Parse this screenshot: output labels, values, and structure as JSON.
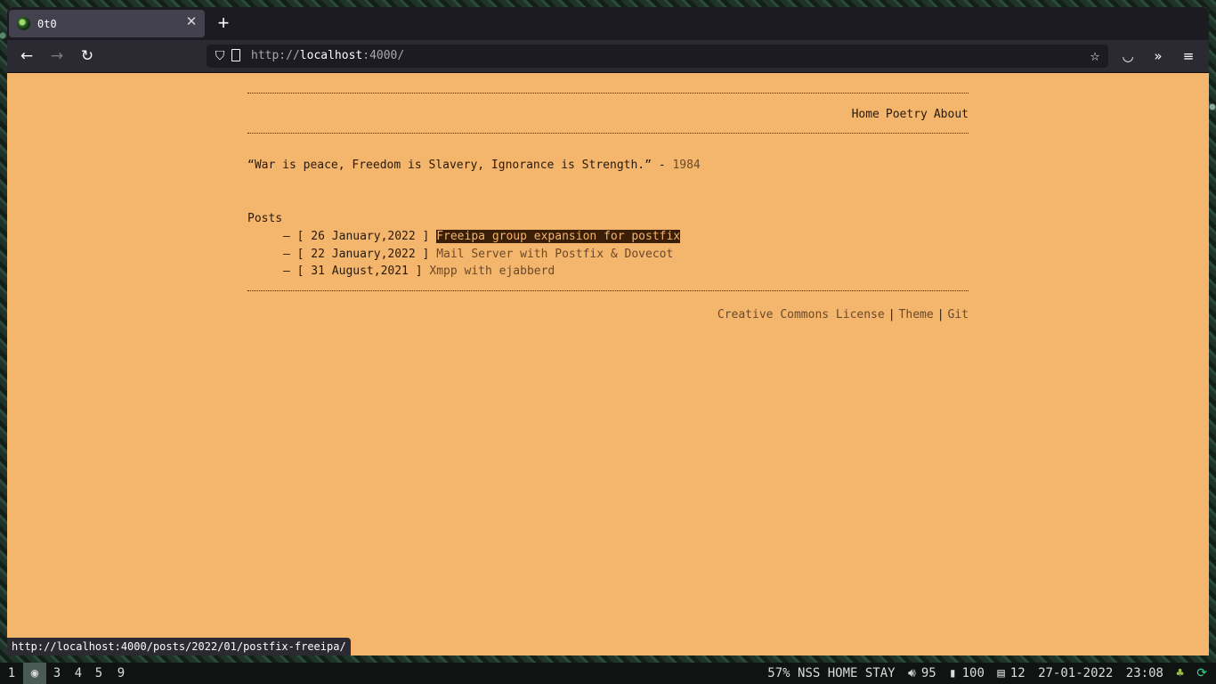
{
  "browser": {
    "tab_title": "0t0",
    "url_scheme": "http://",
    "url_host": "localhost",
    "url_port_path": ":4000/",
    "status_link": "http://localhost:4000/posts/2022/01/postfix-freeipa/"
  },
  "site": {
    "nav": [
      "Home",
      "Poetry",
      "About"
    ],
    "quote_text": "“War is peace, Freedom is Slavery, Ignorance is Strength.” -",
    "quote_source": "1984",
    "posts_heading": "Posts",
    "posts": [
      {
        "prefix": "– [ 26 January,2022 ]",
        "title": "Freeipa group expansion for postfix"
      },
      {
        "prefix": "– [ 22 January,2022 ]",
        "title": "Mail Server with Postfix & Dovecot"
      },
      {
        "prefix": "– [ 31 August,2021 ]",
        "title": "Xmpp with ejabberd"
      }
    ],
    "footer": {
      "license": "Creative Commons License",
      "sep": "|",
      "theme": "Theme",
      "git": "Git"
    }
  },
  "system_bar": {
    "workspaces": [
      "1",
      "",
      "3",
      "4",
      "5",
      "9"
    ],
    "status_text": "57% NSS HOME STAY",
    "volume": "95",
    "battery": "100",
    "memory": "12",
    "date": "27-01-2022",
    "time": "23:08"
  }
}
